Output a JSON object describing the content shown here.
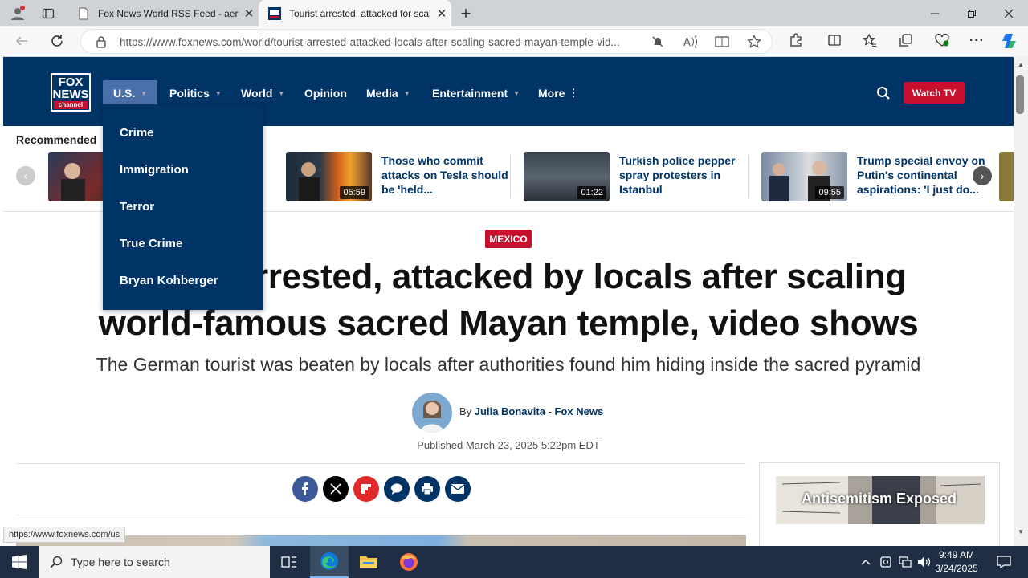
{
  "browser": {
    "tabs": [
      {
        "title": "Fox News World RSS Feed - aero",
        "close": "✕"
      },
      {
        "title": "Tourist arrested, attacked for scal",
        "close": "✕"
      }
    ],
    "new_tab": "+",
    "url": "https://www.foxnews.com/world/tourist-arrested-attacked-locals-after-scaling-sacred-mayan-temple-vid...",
    "status_url": "https://www.foxnews.com/us"
  },
  "site": {
    "logo_lines": [
      "FOX",
      "NEWS",
      "channel"
    ],
    "nav": [
      {
        "label": "U.S.",
        "caret": "▼"
      },
      {
        "label": "Politics",
        "caret": "▼"
      },
      {
        "label": "World",
        "caret": "▼"
      },
      {
        "label": "Opinion",
        "caret": ""
      },
      {
        "label": "Media",
        "caret": "▼"
      },
      {
        "label": "Entertainment",
        "caret": "▼"
      },
      {
        "label": "More",
        "caret": "⋮"
      }
    ],
    "watch_tv": "Watch TV",
    "dropdown": [
      "Crime",
      "Immigration",
      "Terror",
      "True Crime",
      "Bryan Kohberger"
    ]
  },
  "recommended": {
    "label": "Recommended",
    "cards": [
      {
        "title": "",
        "duration": ""
      },
      {
        "title": "Those who commit attacks on Tesla should be 'held...",
        "duration": "05:59"
      },
      {
        "title": "Turkish police pepper spray protesters in Istanbul",
        "duration": "01:22"
      },
      {
        "title": "Trump special envoy on Putin's continental aspirations: 'I just do...",
        "duration": "09:55"
      }
    ]
  },
  "article": {
    "tag": "MEXICO",
    "headline_line1": "Tourist arrested, attacked by locals after scaling",
    "headline_line2": "world-famous sacred Mayan temple, video shows",
    "subhead": "The German tourist was beaten by locals after authorities found him hiding inside the sacred pyramid",
    "by": "By",
    "author": "Julia Bonavita",
    "dash": "-",
    "outlet": "Fox News",
    "published": "Published March 23, 2025 5:22pm EDT",
    "share_icons": [
      "facebook-icon",
      "x-icon",
      "flipboard-icon",
      "comment-icon",
      "print-icon",
      "email-icon"
    ]
  },
  "sidebar": {
    "ad_text": "Antisemitism Exposed"
  },
  "taskbar": {
    "search_placeholder": "Type here to search",
    "time": "9:49 AM",
    "date": "3/24/2025"
  },
  "colors": {
    "fox_navy": "#003366",
    "fox_red": "#c8102e",
    "dropdown_active": "#4b6fa8"
  }
}
